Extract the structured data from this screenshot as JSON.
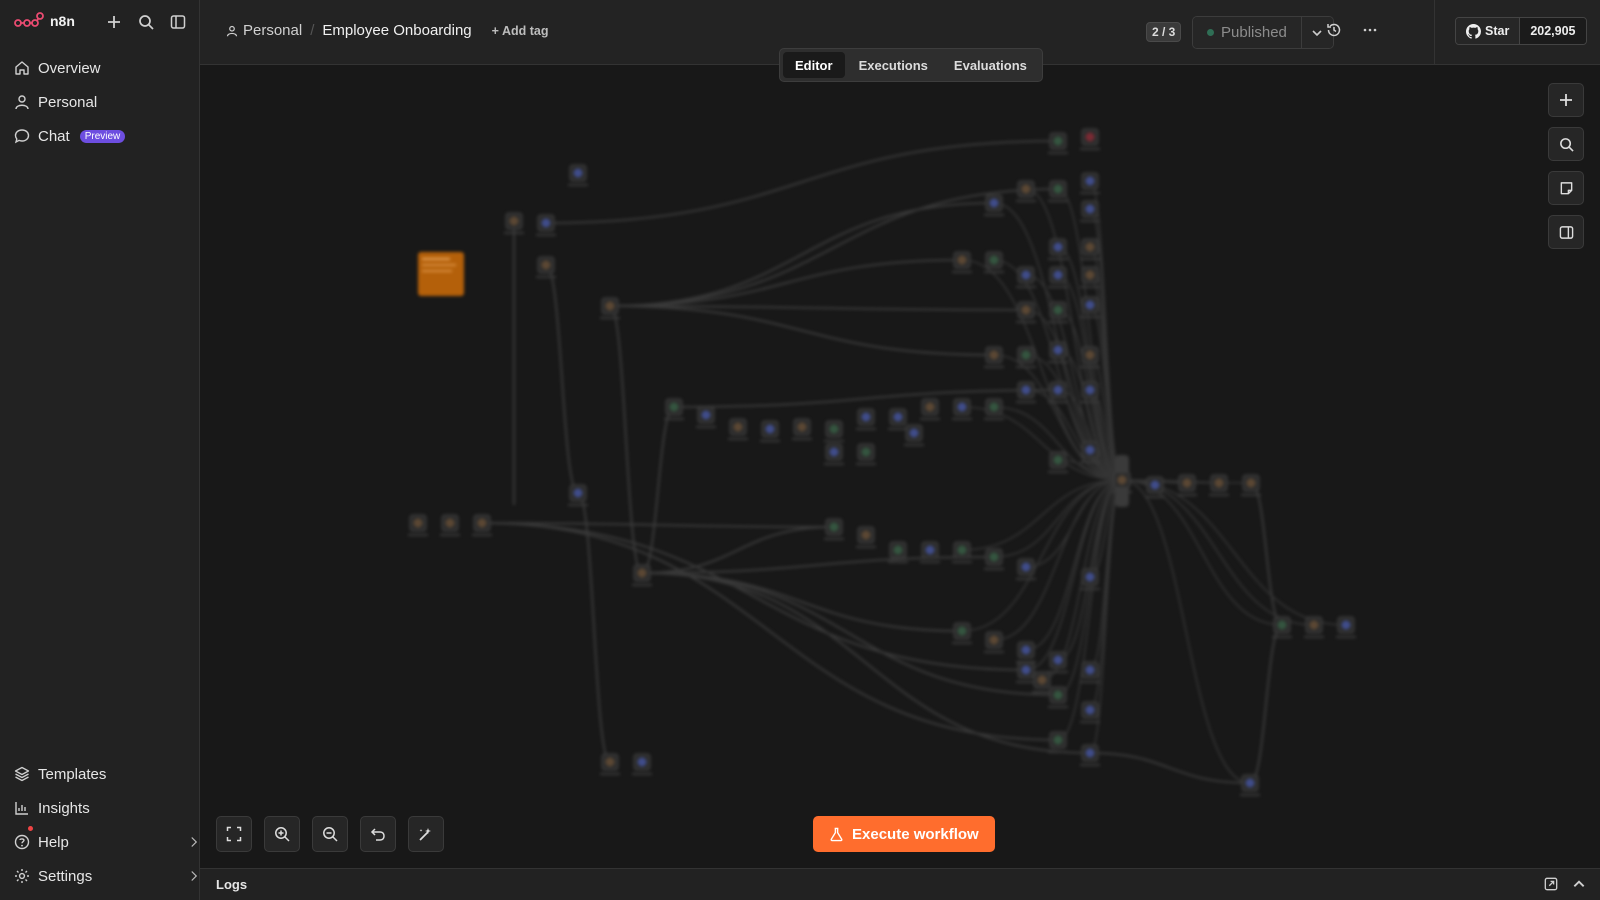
{
  "brand": {
    "name": "n8n"
  },
  "sidebar": {
    "top_items": [
      {
        "label": "Overview",
        "icon": "home-icon"
      },
      {
        "label": "Personal",
        "icon": "user-icon"
      },
      {
        "label": "Chat",
        "icon": "chat-icon",
        "badge": "Preview"
      }
    ],
    "bottom_items": [
      {
        "label": "Templates",
        "icon": "templates-icon"
      },
      {
        "label": "Insights",
        "icon": "chart-icon"
      },
      {
        "label": "Help",
        "icon": "help-icon"
      },
      {
        "label": "Settings",
        "icon": "settings-icon"
      }
    ]
  },
  "header": {
    "project": "Personal",
    "workflow_title": "Employee Onboarding",
    "add_tag": "+ Add tag",
    "version": "2 / 3",
    "published": "Published",
    "github_star": "Star",
    "github_count": "202,905"
  },
  "tabs": [
    {
      "label": "Editor",
      "active": true
    },
    {
      "label": "Executions",
      "active": false
    },
    {
      "label": "Evaluations",
      "active": false
    }
  ],
  "canvas": {
    "execute_label": "Execute workflow"
  },
  "logs": {
    "label": "Logs"
  },
  "colors": {
    "accent": "#ff6d2d",
    "preview_badge": "#6d4ee0",
    "canvas_bg": "#181818",
    "sticky_note": "#b4600a"
  }
}
